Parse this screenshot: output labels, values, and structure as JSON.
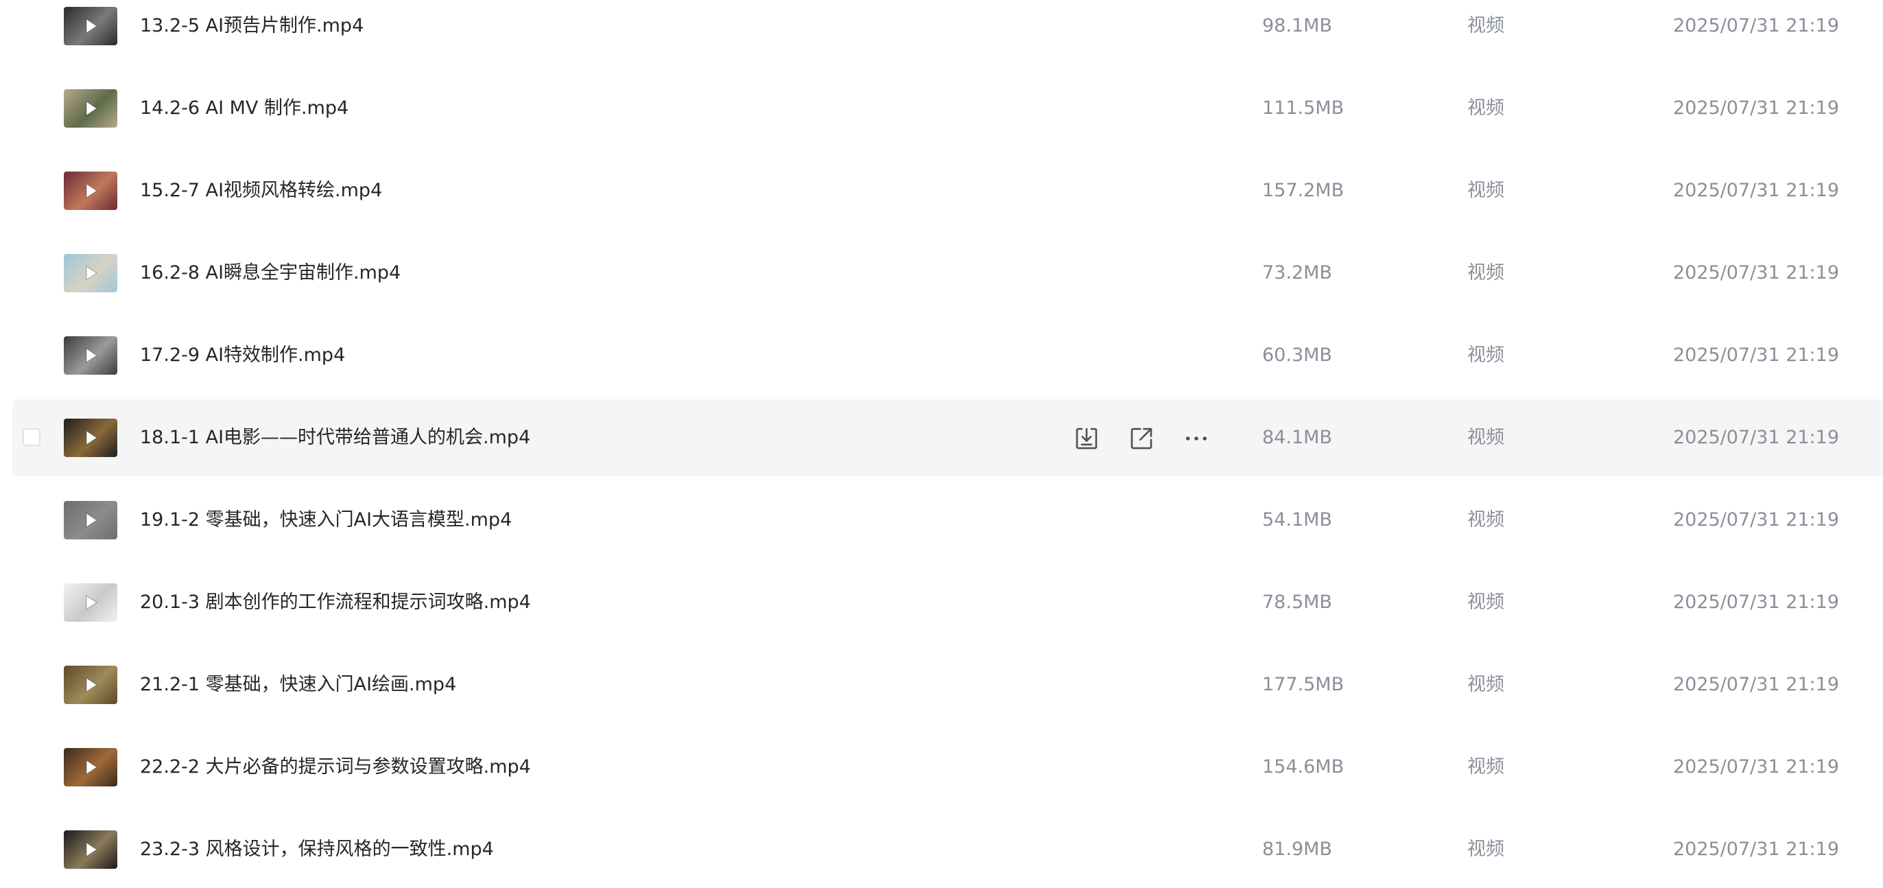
{
  "files": [
    {
      "name": "13.2-5 AI预告片制作.mp4",
      "size": "98.1MB",
      "type": "视频",
      "modified": "2025/07/31 21:19",
      "thumb_colors": [
        "#2b2b2b",
        "#7a7a7a"
      ]
    },
    {
      "name": "14.2-6 AI MV 制作.mp4",
      "size": "111.5MB",
      "type": "视频",
      "modified": "2025/07/31 21:19",
      "thumb_colors": [
        "#b7a98a",
        "#5f6b4a"
      ]
    },
    {
      "name": "15.2-7 AI视频风格转绘.mp4",
      "size": "157.2MB",
      "type": "视频",
      "modified": "2025/07/31 21:19",
      "thumb_colors": [
        "#6b2a3a",
        "#c0785a"
      ]
    },
    {
      "name": "16.2-8 AI瞬息全宇宙制作.mp4",
      "size": "73.2MB",
      "type": "视频",
      "modified": "2025/07/31 21:19",
      "thumb_colors": [
        "#9fc7d6",
        "#d8d2c4"
      ]
    },
    {
      "name": "17.2-9 AI特效制作.mp4",
      "size": "60.3MB",
      "type": "视频",
      "modified": "2025/07/31 21:19",
      "thumb_colors": [
        "#3c3c3c",
        "#9a9a9a"
      ]
    },
    {
      "name": "18.1-1 AI电影——时代带给普通人的机会.mp4",
      "size": "84.1MB",
      "type": "视频",
      "modified": "2025/07/31 21:19",
      "thumb_colors": [
        "#1e1e1e",
        "#8a6a3a"
      ]
    },
    {
      "name": "19.1-2 零基础，快速入门AI大语言模型.mp4",
      "size": "54.1MB",
      "type": "视频",
      "modified": "2025/07/31 21:19",
      "thumb_colors": [
        "#6e6e6e",
        "#8c8c8c"
      ]
    },
    {
      "name": "20.1-3 剧本创作的工作流程和提示词攻略.mp4",
      "size": "78.5MB",
      "type": "视频",
      "modified": "2025/07/31 21:19",
      "thumb_colors": [
        "#f2f2f2",
        "#c9c9c9"
      ]
    },
    {
      "name": "21.2-1 零基础，快速入门AI绘画.mp4",
      "size": "177.5MB",
      "type": "视频",
      "modified": "2025/07/31 21:19",
      "thumb_colors": [
        "#5a4a2a",
        "#a08a5a"
      ]
    },
    {
      "name": "22.2-2 大片必备的提示词与参数设置攻略.mp4",
      "size": "154.6MB",
      "type": "视频",
      "modified": "2025/07/31 21:19",
      "thumb_colors": [
        "#3a2a1a",
        "#a06a3a"
      ]
    },
    {
      "name": "23.2-3 风格设计，保持风格的一致性.mp4",
      "size": "81.9MB",
      "type": "视频",
      "modified": "2025/07/31 21:19",
      "thumb_colors": [
        "#1a1a1a",
        "#8a7a5a"
      ]
    }
  ],
  "hovered_row": 5,
  "row_actions": [
    "download-icon",
    "share-icon",
    "more-icon"
  ],
  "colors": {
    "hover_bg": "#f5f5f6",
    "name_text": "#25262b",
    "meta_text": "#8b8f99",
    "icon_stroke": "#4e5158"
  }
}
